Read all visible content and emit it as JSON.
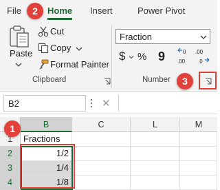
{
  "ribbon": {
    "tabs": [
      {
        "label": "File"
      },
      {
        "label": "Home"
      },
      {
        "label": "Insert"
      },
      {
        "label": "Power Pivot"
      }
    ],
    "clipboard": {
      "paste_label": "Paste",
      "cut_label": "Cut",
      "copy_label": "Copy",
      "format_painter_label": "Format Painter",
      "group_label": "Clipboard"
    },
    "number": {
      "format_value": "Fraction",
      "currency_symbol": "$",
      "percent_symbol": "%",
      "comma_symbol": "9",
      "group_label": "Number"
    }
  },
  "formula_bar": {
    "name_box": "B2",
    "cancel_symbol": "✕",
    "formula": ""
  },
  "grid": {
    "columns": [
      "B",
      "C",
      "L",
      "M"
    ],
    "rows": [
      "1",
      "2",
      "3",
      "4"
    ],
    "cells": {
      "B1": "Fractions",
      "B2": "1/2",
      "B3": "1/4",
      "B4": "1/8"
    }
  },
  "callouts": [
    "1",
    "2",
    "3"
  ],
  "colors": {
    "accent_green": "#1e6b35",
    "callout_red": "#e2403a",
    "selection_gray": "#d9d9d9"
  }
}
